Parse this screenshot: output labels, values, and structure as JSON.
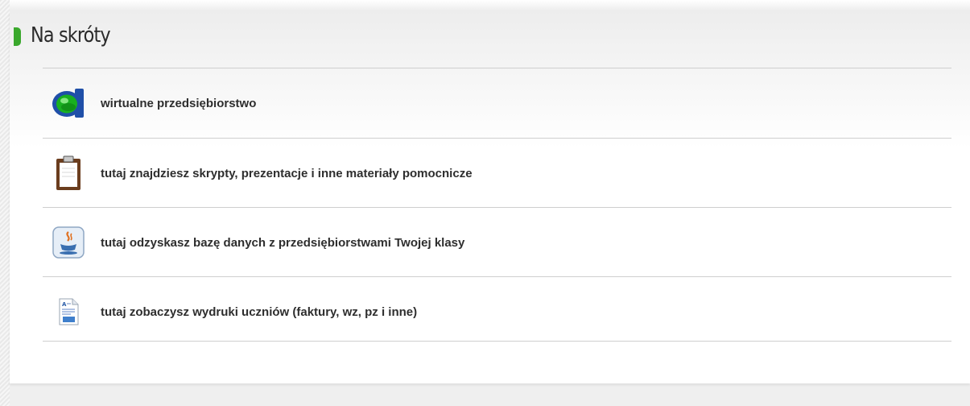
{
  "section": {
    "title": "Na skróty",
    "accent_color": "#3aa82c"
  },
  "shortcuts": [
    {
      "icon": "virtual-company-logo-icon",
      "label": "wirtualne przedsiębiorstwo"
    },
    {
      "icon": "clipboard-icon",
      "label": "tutaj znajdziesz skrypty, prezentacje i inne materiały pomocnicze"
    },
    {
      "icon": "java-icon",
      "label": "tutaj odzyskasz bazę danych z przedsiębiorstwami Twojej klasy"
    },
    {
      "icon": "document-printout-icon",
      "label": "tutaj zobaczysz wydruki uczniów (faktury, wz, pz i inne)"
    }
  ]
}
